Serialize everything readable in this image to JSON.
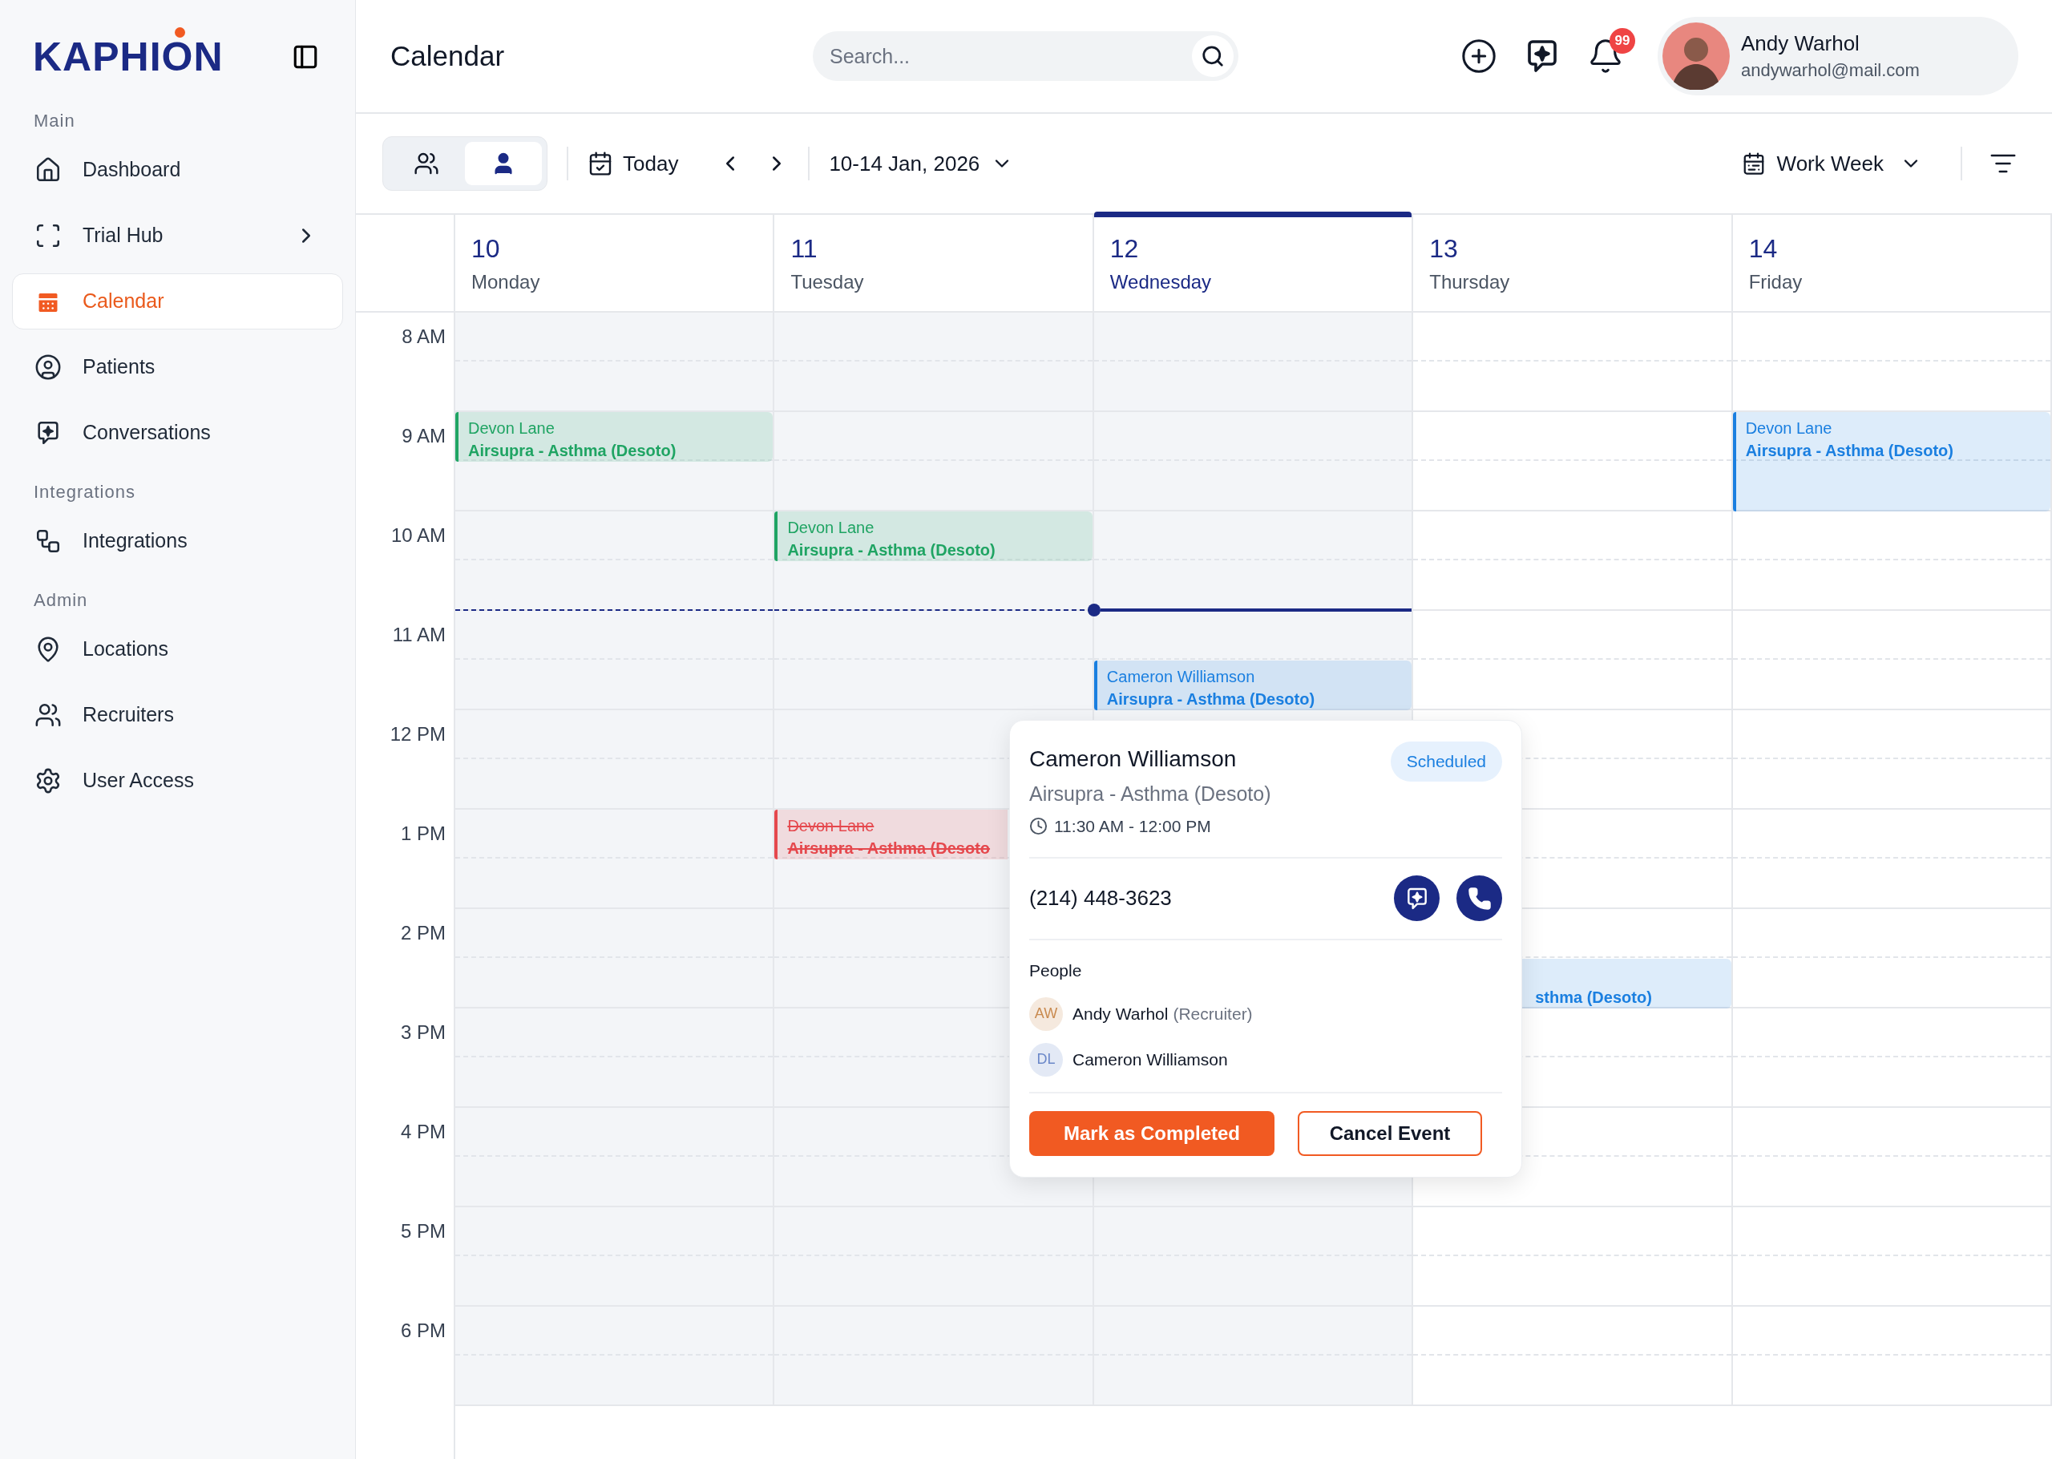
{
  "sidebar": {
    "logo": "KAPHION",
    "sections": [
      {
        "label": "Main",
        "items": [
          {
            "label": "Dashboard",
            "kind": "link",
            "selected": false
          },
          {
            "label": "Trial Hub",
            "kind": "submenu",
            "selected": false
          },
          {
            "label": "Calendar",
            "kind": "link",
            "selected": true
          },
          {
            "label": "Patients",
            "kind": "link",
            "selected": false
          },
          {
            "label": "Conversations",
            "kind": "link",
            "selected": false
          }
        ]
      },
      {
        "label": "Integrations",
        "items": [
          {
            "label": "Integrations",
            "kind": "link",
            "selected": false
          }
        ]
      },
      {
        "label": "Admin",
        "items": [
          {
            "label": "Locations",
            "kind": "link",
            "selected": false
          },
          {
            "label": "Recruiters",
            "kind": "link",
            "selected": false
          },
          {
            "label": "User Access",
            "kind": "link",
            "selected": false
          }
        ]
      }
    ]
  },
  "header": {
    "title": "Calendar",
    "search": {
      "placeholder": "Search..."
    },
    "notification_count": "99",
    "user": {
      "name": "Andy Warhol",
      "email": "andywarhol@mail.com"
    }
  },
  "toolbar": {
    "view_toggle": [
      {
        "selected": false
      },
      {
        "selected": true
      }
    ],
    "today": "Today",
    "range": "10-14 Jan, 2026",
    "view": "Work Week"
  },
  "days": [
    {
      "number": "10",
      "name": "Monday",
      "selected": false,
      "past": true
    },
    {
      "number": "11",
      "name": "Tuesday",
      "selected": false,
      "past": true
    },
    {
      "number": "12",
      "name": "Wednesday",
      "selected": true,
      "past": true
    },
    {
      "number": "13",
      "name": "Thursday",
      "selected": false,
      "past": false
    },
    {
      "number": "14",
      "name": "Friday",
      "selected": false,
      "past": false
    }
  ],
  "hours": [
    {
      "label": "8 AM",
      "current": false,
      "cells": [
        {},
        {},
        {},
        {},
        {}
      ]
    },
    {
      "label": "9 AM",
      "current": false,
      "cells": [
        {
          "events": [
            {
              "kind": "early-half",
              "name": "Devon Lane",
              "detail": "Airsupra - Asthma (Desoto)",
              "color": "#1fa463",
              "cancelled": false
            }
          ]
        },
        {},
        {},
        {},
        {
          "events": [
            {
              "kind": "full-hour",
              "name": "Devon Lane",
              "detail": "Airsupra - Asthma (Desoto)",
              "color": "#1a7fe0",
              "cancelled": false
            }
          ]
        }
      ]
    },
    {
      "label": "10 AM",
      "current": false,
      "cells": [
        {},
        {
          "events": [
            {
              "kind": "early-half",
              "name": "Devon Lane",
              "detail": "Airsupra - Asthma (Desoto)",
              "color": "#1fa463",
              "cancelled": false
            }
          ]
        },
        {},
        {},
        {}
      ]
    },
    {
      "label": "11 AM",
      "current": true,
      "cells": [
        {},
        {},
        {
          "events": [
            {
              "kind": "late-half",
              "name": "Cameron Williamson",
              "detail": "Airsupra - Asthma (Desoto)",
              "color": "#1a7fe0",
              "cancelled": false
            }
          ]
        },
        {},
        {}
      ]
    },
    {
      "label": "12 PM",
      "current": false,
      "cells": [
        {},
        {},
        {},
        {},
        {}
      ]
    },
    {
      "label": "1 PM",
      "current": false,
      "cells": [
        {},
        {
          "events": [
            {
              "kind": "early-half",
              "name": "Devon Lane",
              "detail": "Airsupra - Asthma (Desoto",
              "color": "#e5484d",
              "cancelled": true
            }
          ]
        },
        {},
        {},
        {}
      ]
    },
    {
      "label": "2 PM",
      "current": false,
      "cells": [
        {},
        {},
        {},
        {
          "events": [
            {
              "kind": "late-half",
              "detail": "sthma (Desoto)",
              "color": "#1a7fe0",
              "cancelled": false
            }
          ]
        },
        {}
      ]
    },
    {
      "label": "3 PM",
      "current": false,
      "cells": [
        {},
        {},
        {},
        {},
        {}
      ]
    },
    {
      "label": "4 PM",
      "current": false,
      "cells": [
        {},
        {},
        {},
        {},
        {}
      ]
    },
    {
      "label": "5 PM",
      "current": false,
      "cells": [
        {},
        {},
        {},
        {},
        {}
      ]
    },
    {
      "label": "6 PM",
      "current": false,
      "cells": [
        {},
        {},
        {},
        {},
        {}
      ]
    }
  ],
  "popover": {
    "name": "Cameron Williamson",
    "status": "Scheduled",
    "detail": "Airsupra - Asthma (Desoto)",
    "time": "11:30 AM - 12:00 PM",
    "phone": "(214) 448-3623",
    "people_title": "People",
    "people": [
      {
        "initials": "AW",
        "name": "Andy Warhol",
        "role": "(Recruiter)",
        "color": "#c98a4f"
      },
      {
        "initials": "DL",
        "name": "Cameron Williamson",
        "color": "#6b88c9"
      }
    ],
    "buttons": [
      {
        "label": "Mark as Completed",
        "kind": "primary"
      },
      {
        "label": "Cancel Event",
        "kind": "secondary"
      }
    ]
  }
}
